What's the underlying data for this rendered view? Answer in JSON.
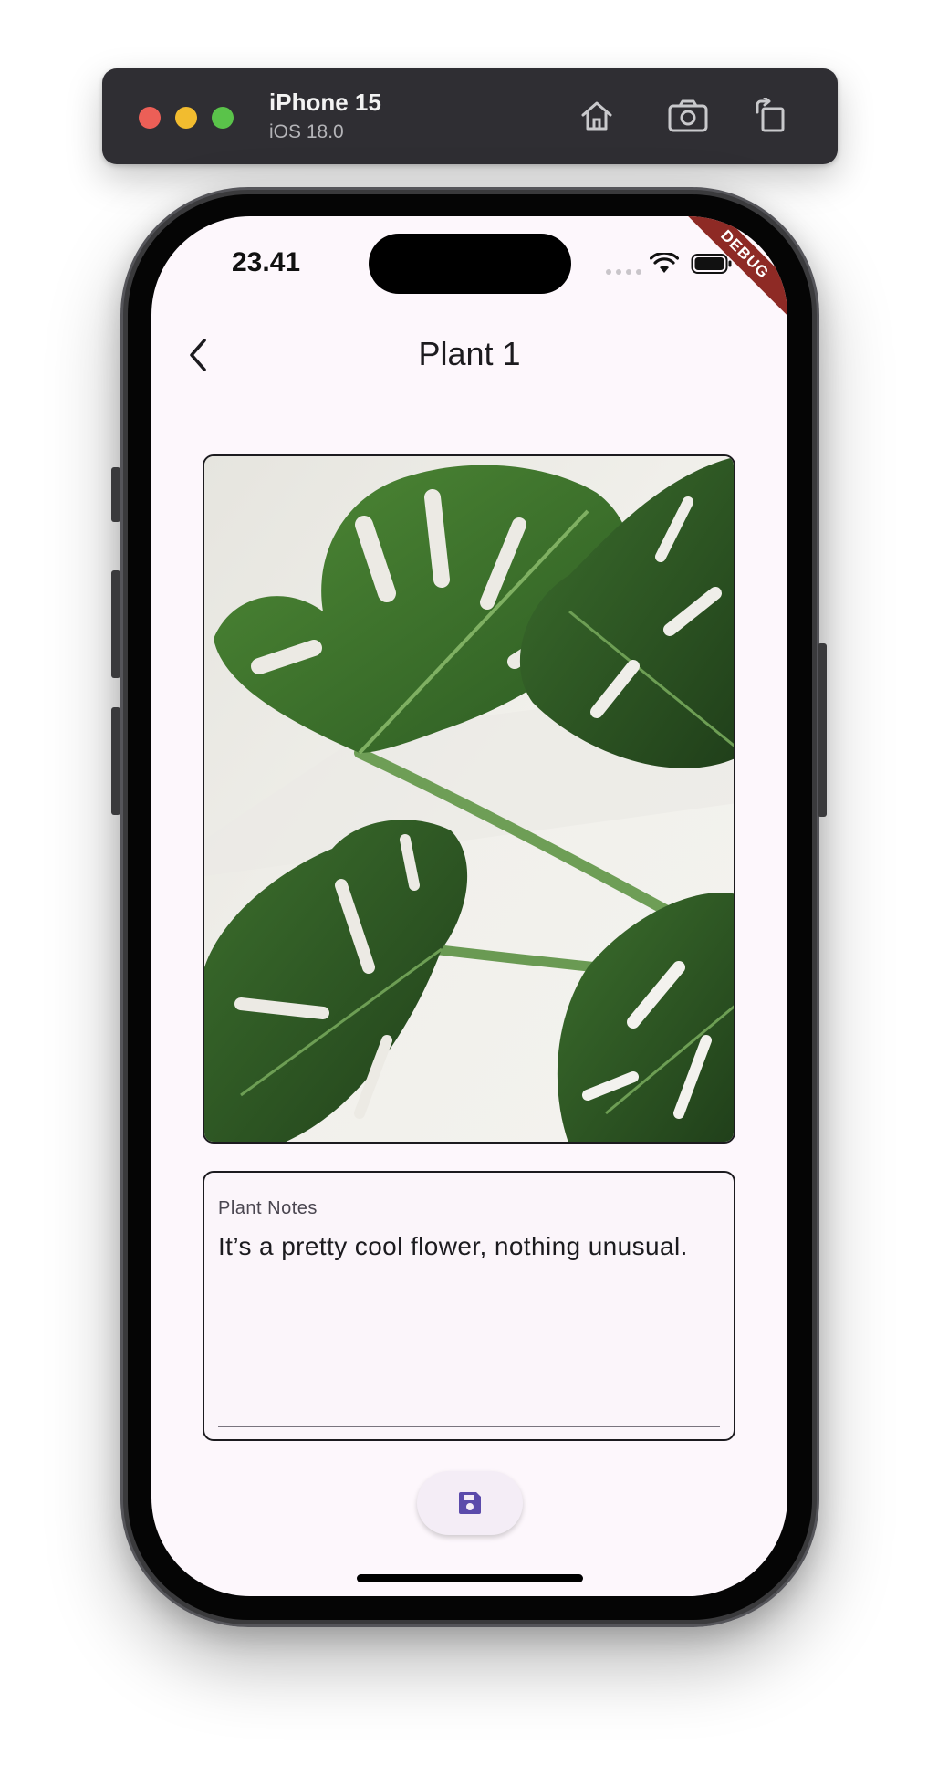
{
  "simulator": {
    "device_name": "iPhone 15",
    "os_version": "iOS 18.0",
    "toolbar_icons": [
      "home-icon",
      "screenshot-icon",
      "rotate-icon"
    ]
  },
  "status_bar": {
    "time": "23.41",
    "debug_banner": "DEBUG"
  },
  "app_bar": {
    "title": "Plant 1",
    "back_icon": "chevron-left-icon"
  },
  "plant_image": {
    "subject": "monstera leaves photo"
  },
  "notes": {
    "label": "Plant Notes",
    "value": "It’s a pretty cool flower, nothing unusual."
  },
  "actions": {
    "save_icon": "floppy-disk-icon"
  },
  "colors": {
    "background": "#fdf7fc",
    "accent": "#5b4bab",
    "debug_banner": "#8e2a25",
    "toolbar": "#2f2e33"
  }
}
